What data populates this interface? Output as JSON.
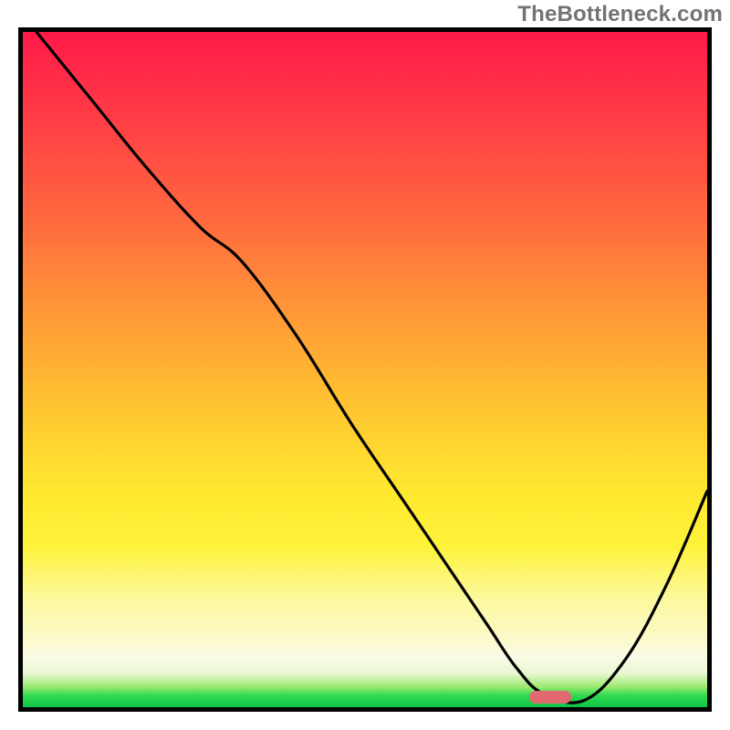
{
  "watermark": "TheBottleneck.com",
  "chart_data": {
    "type": "line",
    "title": "",
    "xlabel": "",
    "ylabel": "",
    "xlim": [
      0,
      100
    ],
    "ylim": [
      0,
      100
    ],
    "grid": false,
    "series": [
      {
        "name": "curve",
        "x": [
          2,
          10,
          18,
          26,
          32,
          40,
          48,
          56,
          60,
          64,
          68,
          72,
          76,
          82,
          88,
          94,
          100
        ],
        "y": [
          100,
          90,
          80,
          71,
          66,
          55,
          42,
          30,
          24,
          18,
          12,
          6,
          2,
          1,
          7,
          18,
          32
        ]
      }
    ],
    "marker": {
      "x": 77,
      "y": 1.5
    },
    "background_gradient": {
      "stops": [
        {
          "pct": 0,
          "color": "#ff1a48"
        },
        {
          "pct": 28,
          "color": "#ff6a3e"
        },
        {
          "pct": 56,
          "color": "#ffc631"
        },
        {
          "pct": 76,
          "color": "#fef239"
        },
        {
          "pct": 92.5,
          "color": "#fbfae6"
        },
        {
          "pct": 98.3,
          "color": "#2fd94f"
        },
        {
          "pct": 100,
          "color": "#0cc54a"
        }
      ]
    }
  }
}
